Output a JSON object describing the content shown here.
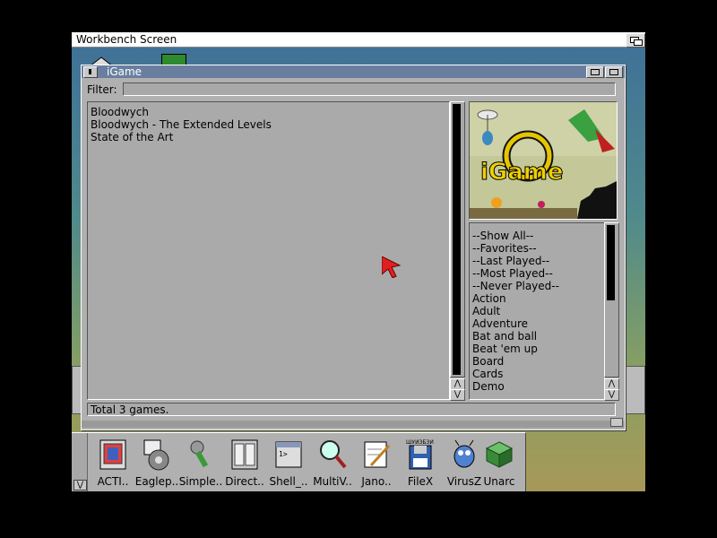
{
  "screen": {
    "title": "Workbench Screen"
  },
  "window": {
    "title": "iGame",
    "filter": {
      "label": "Filter:",
      "value": ""
    },
    "games": [
      "Bloodwych",
      "Bloodwych - The Extended Levels",
      "State of the Art"
    ],
    "genres": [
      "--Show All--",
      "--Favorites--",
      "--Last Played--",
      "--Most Played--",
      "--Never Played--",
      "Action",
      "Adult",
      "Adventure",
      "Bat and ball",
      "Beat 'em up",
      "Board",
      "Cards",
      "Demo"
    ],
    "status": "Total 3 games.",
    "logo_text": "iGame"
  },
  "dock": {
    "items": [
      {
        "label": "ACTI..",
        "icon": "actions-icon"
      },
      {
        "label": "Eaglep..",
        "icon": "eagleplayer-icon"
      },
      {
        "label": "Simple..",
        "icon": "simple-tool-icon"
      },
      {
        "label": "Direct..",
        "icon": "directory-opus-icon"
      },
      {
        "label": "Shell_..",
        "icon": "shell-icon"
      },
      {
        "label": "MultiV..",
        "icon": "magnifier-icon"
      },
      {
        "label": "Jano..",
        "icon": "notepad-icon"
      },
      {
        "label": "FileX",
        "icon": "floppy-icon"
      },
      {
        "label": "VirusZ",
        "icon": "bug-icon"
      },
      {
        "label": "Unarc",
        "icon": "cube-icon"
      }
    ],
    "badge_text": "ШУИЗБЗИ"
  },
  "colors": {
    "title_bar": "#6a7fa0",
    "panel": "#aaaaaa",
    "window": "#b0b0b0"
  }
}
